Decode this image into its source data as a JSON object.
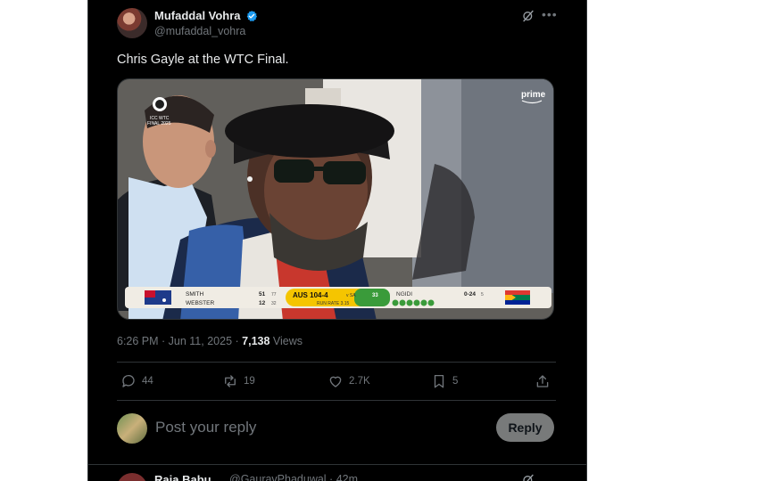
{
  "tweet": {
    "author_name": "Mufaddal Vohra",
    "author_handle": "@mufaddal_vohra",
    "text": "Chris Gayle at the WTC Final.",
    "timestamp": "6:26 PM · Jun 11, 2025 ·",
    "views_count": "7,138",
    "views_label": "Views",
    "verified_color": "#1d9bf0"
  },
  "media": {
    "broadcaster_logo": "prime",
    "event_logo": "ICC WTC FINAL 2025",
    "scorebar": {
      "batter1_name": "SMITH",
      "batter1_runs": "51",
      "batter1_balls": "77",
      "batter2_name": "WEBSTER",
      "batter2_runs": "12",
      "batter2_balls": "32",
      "team_score": "AUS 104-4",
      "vs_label": "v SA",
      "overs": "33",
      "run_rate": "RUN RATE 3.15",
      "bowler_name": "NGIDI",
      "bowler_figures": "0-24",
      "bowler_overs": "5"
    }
  },
  "actions": {
    "replies": "44",
    "reposts": "19",
    "likes": "2.7K",
    "bookmarks": "5"
  },
  "reply_box": {
    "placeholder": "Post your reply",
    "button_label": "Reply"
  },
  "next_tweet": {
    "author_name": "Raja Babu",
    "author_handle": "@GauravPhaduwal · 42m"
  }
}
